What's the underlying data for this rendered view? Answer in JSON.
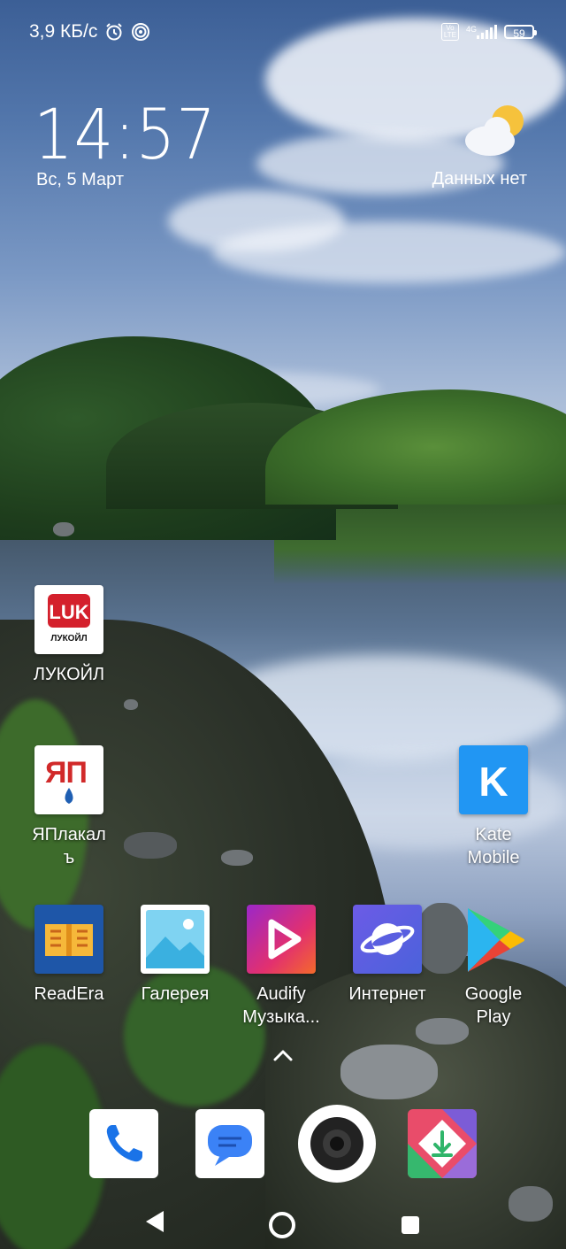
{
  "status_bar": {
    "speed": "3,9 КБ/с",
    "network": "4G",
    "volte": "Vo\nLTE",
    "battery": "59",
    "icons": [
      "alarm-icon",
      "hotspot-icon",
      "volte-icon",
      "signal-icon",
      "battery-icon"
    ]
  },
  "clock_widget": {
    "time": "14:57",
    "date": "Вс, 5 Март"
  },
  "weather_widget": {
    "icon": "partly-cloudy-icon",
    "text": "Данных нет"
  },
  "apps": [
    {
      "label": "ЛУКОЙЛ",
      "icon": "lukoil-icon"
    },
    {
      "label": "ЯПлакал\nъ",
      "icon": "yaplakal-icon"
    },
    {
      "label": "Kate\nMobile",
      "icon": "kate-mobile-icon"
    },
    {
      "label": "ReadEra",
      "icon": "readera-icon"
    },
    {
      "label": "Галерея",
      "icon": "gallery-icon"
    },
    {
      "label": "Audify\nМузыка...",
      "icon": "audify-icon"
    },
    {
      "label": "Интернет",
      "icon": "internet-icon"
    },
    {
      "label": "Google\nPlay",
      "icon": "google-play-icon"
    }
  ],
  "icon_text": {
    "lukoil_brand": "ЛУКОЙЛ",
    "yaplakal_letters": "ЯП",
    "kate_letter": "K"
  },
  "dock": [
    {
      "icon": "phone-icon"
    },
    {
      "icon": "messages-icon"
    },
    {
      "icon": "camera-icon"
    },
    {
      "icon": "downloader-icon"
    }
  ],
  "nav_bar": {
    "buttons": [
      "back-button",
      "home-button",
      "recents-button"
    ]
  },
  "colors": {
    "kate": "#2196f3",
    "readera": "#1e56a8",
    "audify": "#e2306f",
    "internet": "#5b5fe0",
    "dock_icon_bg": "#ffffff"
  }
}
